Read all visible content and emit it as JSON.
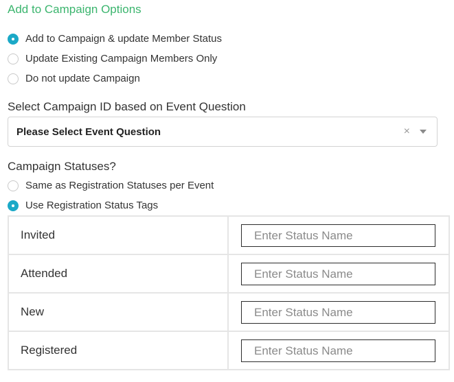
{
  "section_title": "Add to Campaign Options",
  "campaign_options": [
    {
      "label": "Add to Campaign & update Member Status",
      "checked": true
    },
    {
      "label": "Update Existing Campaign Members Only",
      "checked": false
    },
    {
      "label": "Do not update Campaign",
      "checked": false
    }
  ],
  "campaign_id_label": "Select Campaign ID based on Event Question",
  "event_question_select": {
    "value": "Please Select Event Question",
    "clear_icon": "×",
    "arrow_icon": "chevron-down-icon"
  },
  "campaign_statuses_label": "Campaign Statuses?",
  "status_options": [
    {
      "label": "Same as Registration Statuses per Event",
      "checked": false
    },
    {
      "label": "Use Registration Status Tags",
      "checked": true
    }
  ],
  "status_rows": [
    {
      "name": "Invited",
      "placeholder": "Enter Status Name",
      "value": ""
    },
    {
      "name": "Attended",
      "placeholder": "Enter Status Name",
      "value": ""
    },
    {
      "name": "New",
      "placeholder": "Enter Status Name",
      "value": ""
    },
    {
      "name": "Registered",
      "placeholder": "Enter Status Name",
      "value": ""
    }
  ],
  "colors": {
    "accent_green": "#3bb56e",
    "radio_checked": "#1ba9c7",
    "border": "#e5e5e5"
  }
}
